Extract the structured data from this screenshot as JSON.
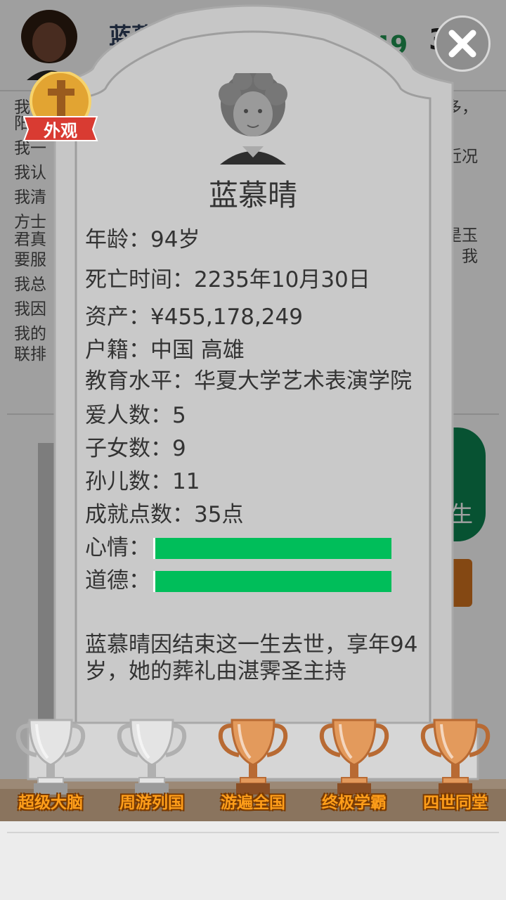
{
  "background": {
    "player_name": "蓝慕晴",
    "money_fragment": "249",
    "money_fragment2": "3",
    "log_lines": [
      "我",
      "阳",
      "我一",
      "我认",
      "我清",
      "方士",
      "君真",
      "要服",
      "我总",
      "我因",
      "我的",
      "联排"
    ],
    "log_right": [
      "多，",
      "近况",
      "是玉",
      "我"
    ],
    "side_button_label": "生",
    "colors": {
      "green": "#0b7a4a",
      "orange": "#c36a1c"
    }
  },
  "badge": {
    "label": "外观",
    "icon": "cross-icon"
  },
  "close": {
    "icon": "close-icon"
  },
  "tombstone": {
    "name": "蓝慕晴",
    "age": "年龄：94岁",
    "death_time": "死亡时间：2235年10月30日",
    "assets": "资产：¥455,178,249",
    "hukou": "户籍：中国 高雄",
    "education": "教育水平：华夏大学艺术表演学院",
    "lovers": "爱人数：5",
    "children": "子女数：9",
    "grandchildren": "孙儿数：11",
    "achievement_points": "成就点数：35点",
    "mood_label": "心情：",
    "mood_level": 1.0,
    "morality_label": "道德：",
    "morality_level": 1.0,
    "epitaph": "蓝慕晴因结束这一生去世，享年94岁，她的葬礼由湛霁圣主持",
    "bar_color": "#00be5a"
  },
  "trophies": [
    {
      "label": "超级大脑",
      "tier": "silver"
    },
    {
      "label": "周游列国",
      "tier": "silver"
    },
    {
      "label": "游遍全国",
      "tier": "bronze"
    },
    {
      "label": "终极学霸",
      "tier": "bronze"
    },
    {
      "label": "四世同堂",
      "tier": "bronze"
    }
  ]
}
